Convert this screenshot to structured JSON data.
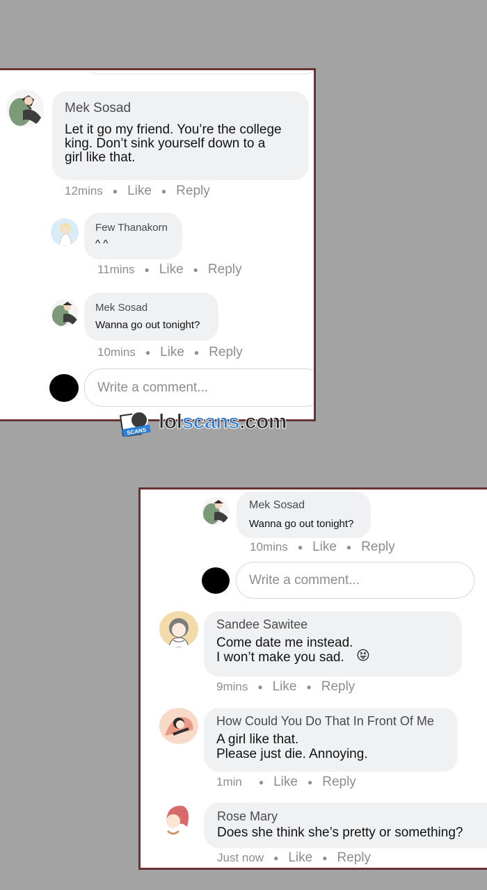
{
  "panel_top": {
    "comments": [
      {
        "name": "Mek Sosad",
        "text": "Let it go my friend. You’re the college\nking. Don’t sink yourself down to a\ngirl like that.",
        "time": "12mins",
        "like": "Like",
        "reply": "Reply"
      },
      {
        "name": "Few Thanakorn",
        "text": "^ ^",
        "time": "11mins",
        "like": "Like",
        "reply": "Reply"
      },
      {
        "name": "Mek Sosad",
        "text": "Wanna go out tonight?",
        "time": "10mins",
        "like": "Like",
        "reply": "Reply"
      }
    ],
    "input_placeholder": "Write a comment..."
  },
  "watermark": {
    "part1": "lol",
    "part2": "scans",
    "part3": ".com",
    "badge": "SCANS"
  },
  "panel_bottom": {
    "comments": [
      {
        "name": "Mek Sosad",
        "text": "Wanna go out tonight?",
        "time": "10mins",
        "like": "Like",
        "reply": "Reply"
      },
      {
        "name": "Sandee Sawitee",
        "text": "Come date me instead.\nI won’t make you sad.",
        "emoji": "😝",
        "time": "9mins",
        "like": "Like",
        "reply": "Reply"
      },
      {
        "name": "How Could You Do That In Front Of Me",
        "text": "A girl like that.\nPlease just die. Annoying.",
        "time": "1min",
        "like": "Like",
        "reply": "Reply"
      },
      {
        "name": "Rose Mary",
        "text": "Does she think she’s pretty or something?",
        "time": "Just now",
        "like": "Like",
        "reply": "Reply"
      }
    ],
    "input_placeholder": "Write a comment..."
  },
  "colors": {
    "background": "#a3a3a3",
    "panel_border": "#6b3232",
    "bubble": "#f0f1f3",
    "meta_text": "#8a8d91",
    "watermark_accent": "#2b7fd6"
  },
  "icons": [
    "avatar-mek-sosad",
    "avatar-few-thanakorn",
    "avatar-sandee-sawitee",
    "avatar-how-could-you",
    "avatar-rose-mary",
    "self-avatar",
    "tongue-out-emoji",
    "lolscans-logo"
  ]
}
